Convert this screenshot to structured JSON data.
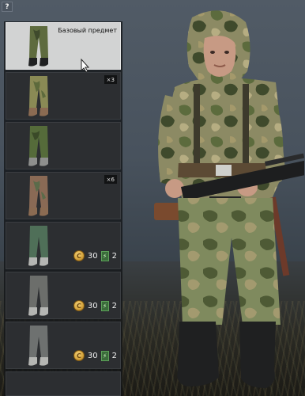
{
  "help_button": {
    "label": "?"
  },
  "item_list": {
    "items": [
      {
        "title": "Базовый предмет",
        "selected": true,
        "pants_color": "#5e6b3e"
      },
      {
        "count": "×3",
        "pants_color": "#8a8a55"
      },
      {
        "pants_color": "#556b3a"
      },
      {
        "count": "×6",
        "pants_color": "#8a6a55"
      },
      {
        "price_coins": "30",
        "price_tickets": "2",
        "pants_color": "#4f6f58"
      },
      {
        "price_coins": "30",
        "price_tickets": "2",
        "pants_color": "#6c6e6b"
      },
      {
        "price_coins": "30",
        "price_tickets": "2",
        "pants_color": "#6e7170"
      }
    ]
  },
  "icons": {
    "coin": "gold-coin-icon",
    "ticket": "ticket-icon",
    "help": "help-icon"
  },
  "colors": {
    "selected_bg": "#d2d3d3",
    "item_bg": "#2c2e31",
    "coin": "#d8a73f",
    "ticket": "#3a6b3a"
  }
}
